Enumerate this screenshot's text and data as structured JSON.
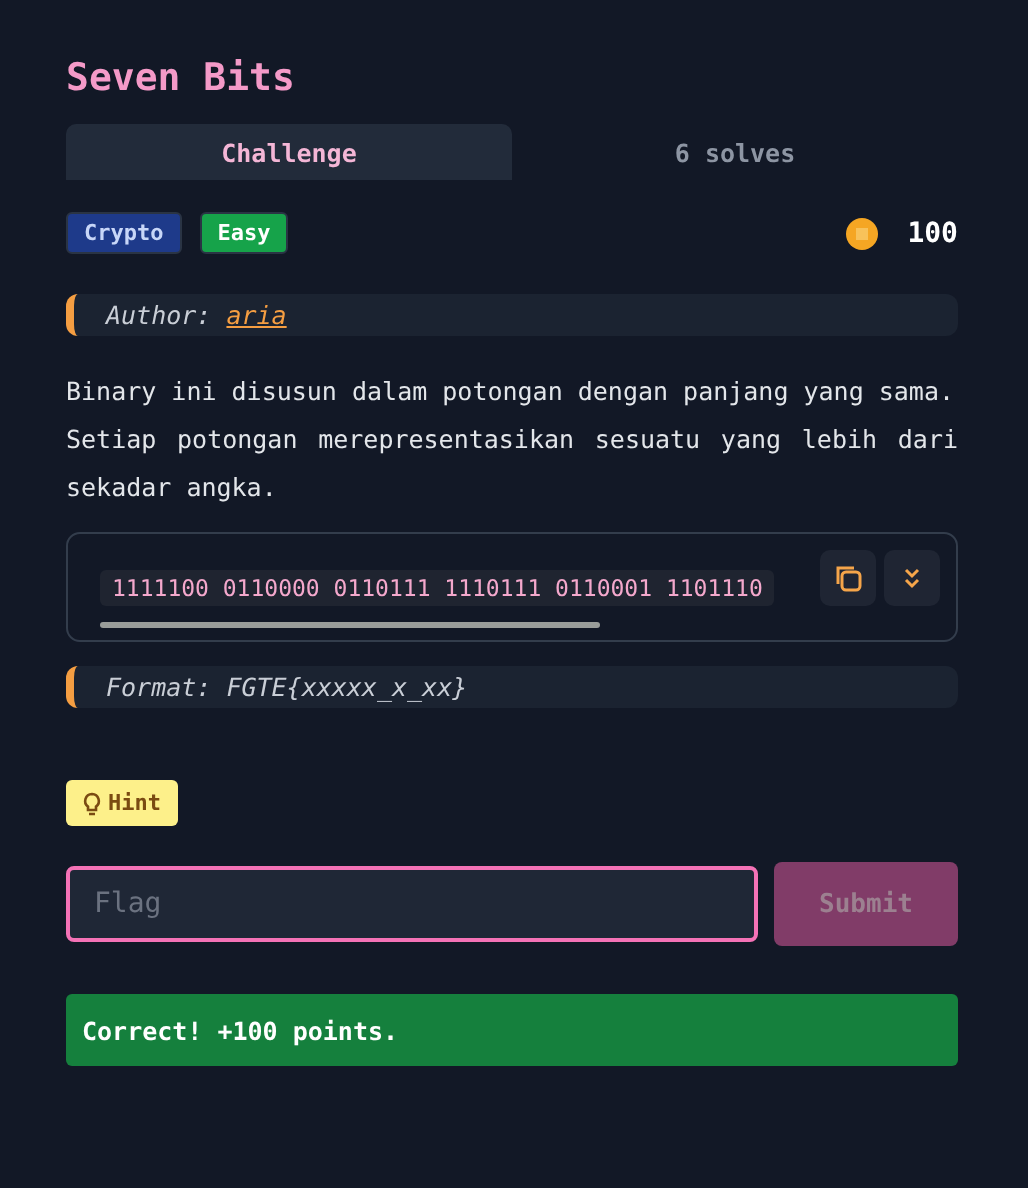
{
  "title": "Seven Bits",
  "tabs": [
    {
      "label": "Challenge",
      "selected": true
    },
    {
      "label": "6 solves",
      "selected": false
    }
  ],
  "tags": [
    {
      "label": "Crypto",
      "kind": "category"
    },
    {
      "label": "Easy",
      "kind": "difficulty"
    }
  ],
  "points": "100",
  "author": {
    "label": "Author:",
    "name": "aria"
  },
  "description": [
    "Binary ini disusun dalam potongan dengan panjang yang sama.",
    "Setiap potongan merepresentasikan sesuatu yang lebih dari sekadar angka."
  ],
  "code": "1111100 0110000 0110111 1110111 0110001 1101110",
  "format": "Format: FGTE{xxxxx_x_xx}",
  "hint": {
    "label": "Hint"
  },
  "flag_input": {
    "placeholder": "Flag",
    "focused": true
  },
  "submit": {
    "label": "Submit",
    "disabled": true
  },
  "result": {
    "text": "Correct! +100 points.",
    "success": true
  }
}
